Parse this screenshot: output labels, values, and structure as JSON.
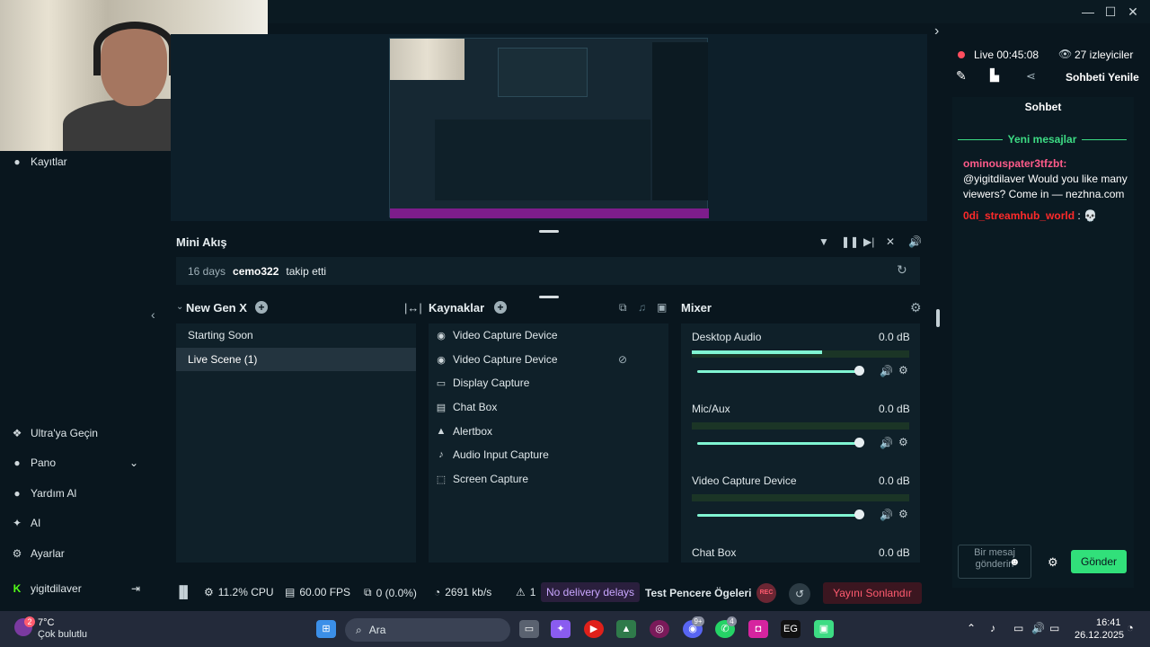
{
  "webcam": {
    "description_icon": "webcam-person"
  },
  "nav": {
    "recordings": "Kayıtlar",
    "ultra": "Ultra'ya Geçin",
    "dashboard": "Pano",
    "help": "Yardım Al",
    "ai": "AI",
    "settings": "Ayarlar",
    "username": "yigitdilaver"
  },
  "mini": {
    "title": "Mini Akış",
    "event": {
      "days": "16 days",
      "user": "cemo322",
      "action": "takip etti"
    }
  },
  "scenes": {
    "title": "New Gen X",
    "items": [
      "Starting Soon",
      "Live Scene (1)"
    ]
  },
  "sources": {
    "title": "Kaynaklar",
    "items": [
      "Video Capture Device",
      "Video Capture Device",
      "Display Capture",
      "Chat Box",
      "Alertbox",
      "Audio Input Capture",
      "Screen Capture"
    ]
  },
  "mixer": {
    "title": "Mixer",
    "channels": [
      {
        "name": "Desktop Audio",
        "db": "0.0 dB",
        "level": 0.6
      },
      {
        "name": "Mic/Aux",
        "db": "0.0 dB",
        "level": 0.0
      },
      {
        "name": "Video Capture Device",
        "db": "0.0 dB",
        "level": 0.0
      },
      {
        "name": "Chat Box",
        "db": "0.0 dB",
        "level": 0.0
      }
    ]
  },
  "status": {
    "cpu": "11.2% CPU",
    "fps": "60.00 FPS",
    "dropped": "0 (0.0%)",
    "bitrate": "2691 kb/s",
    "alerts": "1",
    "delay": "No delivery delays",
    "test_elements": "Test Pencere Ögeleri",
    "rec": "REC",
    "end_stream": "Yayını Sonlandır"
  },
  "chat": {
    "live_label": "Live 00:45:08",
    "viewers": "27 izleyiciler",
    "refresh": "Sohbeti Yenile",
    "title": "Sohbet",
    "new_messages": "Yeni mesajlar",
    "messages": [
      {
        "user": "ominouspater3tfzbt:",
        "text": "@yigitdilaver Would you like many viewers? Come in — nezhna.com"
      },
      {
        "user": "0di_streamhub_world",
        "text": ": 💀"
      }
    ],
    "input_placeholder": "Bir mesaj gönderin",
    "send": "Gönder"
  },
  "taskbar": {
    "weather_temp": "7°C",
    "weather_desc": "Çok bulutlu",
    "weather_badge": "2",
    "search": "Ara",
    "discord_badge": "9+",
    "whatsapp_badge": "4",
    "time": "16:41",
    "date": "26.12.2025"
  },
  "colors": {
    "accent": "#80f5d2",
    "live": "#ff4d5e",
    "send": "#31e07a",
    "danger": "#ff5b6f"
  }
}
